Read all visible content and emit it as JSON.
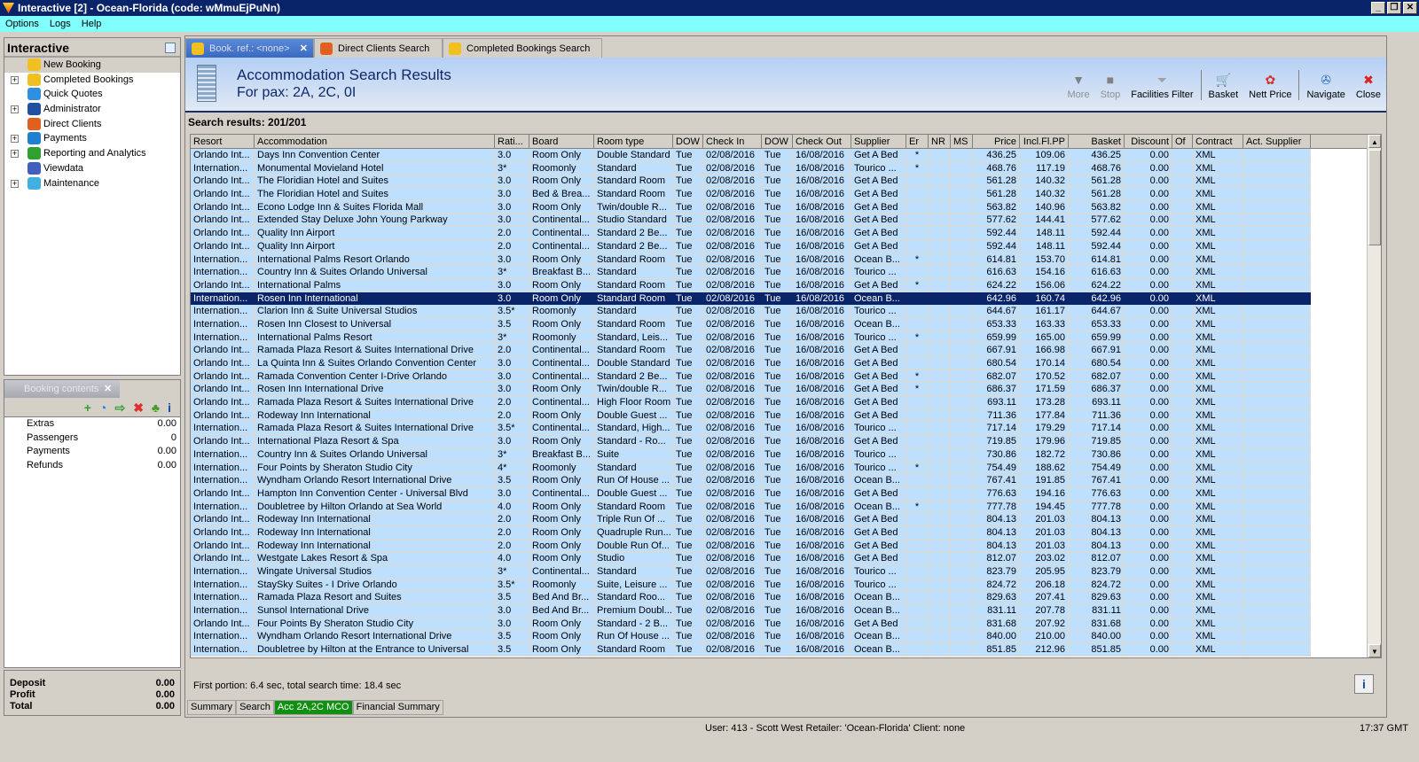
{
  "window": {
    "title": "Interactive [2] - Ocean-Florida (code: wMmuEjPuNn)",
    "buttons": [
      "_",
      "❐",
      "✕"
    ]
  },
  "menu": [
    "Options",
    "Logs",
    "Help"
  ],
  "sidebar": {
    "title": "Interactive",
    "items": [
      {
        "label": "New Booking",
        "expand": false,
        "color": "#f0c020"
      },
      {
        "label": "Completed Bookings",
        "expand": true,
        "color": "#f0c020"
      },
      {
        "label": "Quick Quotes",
        "expand": false,
        "color": "#3090e0"
      },
      {
        "label": "Administrator",
        "expand": true,
        "color": "#2050a0"
      },
      {
        "label": "Direct Clients",
        "expand": false,
        "color": "#e06020"
      },
      {
        "label": "Payments",
        "expand": true,
        "color": "#2080d0"
      },
      {
        "label": "Reporting and Analytics",
        "expand": true,
        "color": "#30a030"
      },
      {
        "label": "Viewdata",
        "expand": false,
        "color": "#4060c0"
      },
      {
        "label": "Maintenance",
        "expand": true,
        "color": "#40b0e0"
      }
    ]
  },
  "booking_contents": {
    "tab_label": "Booking contents",
    "rows": [
      {
        "label": "Extras",
        "value": "0.00"
      },
      {
        "label": "Passengers",
        "value": "0"
      },
      {
        "label": "Payments",
        "value": "0.00"
      },
      {
        "label": "Refunds",
        "value": "0.00"
      }
    ],
    "tools": [
      "+",
      "◔",
      "⇨",
      "✖",
      "♣",
      "i"
    ]
  },
  "totals": [
    {
      "label": "Deposit",
      "value": "0.00"
    },
    {
      "label": "Profit",
      "value": "0.00"
    },
    {
      "label": "Total",
      "value": "0.00"
    }
  ],
  "tabs": [
    {
      "label": "Book. ref.: <none>",
      "active": true
    },
    {
      "label": "Direct Clients Search",
      "active": false
    },
    {
      "label": "Completed Bookings Search",
      "active": false
    }
  ],
  "header": {
    "title": "Accommodation Search Results",
    "subtitle": "For pax: 2A, 2C, 0I"
  },
  "toolbar": [
    {
      "label": "More",
      "glyph": "▼",
      "disabled": true
    },
    {
      "label": "Stop",
      "glyph": "■",
      "disabled": true
    },
    {
      "label": "Facilities Filter",
      "glyph": "⏷",
      "disabled": false,
      "sep_after": true
    },
    {
      "label": "Basket",
      "glyph": "🛒",
      "disabled": false
    },
    {
      "label": "Nett Price",
      "glyph": "✿",
      "disabled": false,
      "sep_after": true
    },
    {
      "label": "Navigate",
      "glyph": "✇",
      "disabled": false
    },
    {
      "label": "Close",
      "glyph": "✖",
      "disabled": false
    }
  ],
  "results_label": "Search results: 201/201",
  "columns": [
    "Resort",
    "Accommodation",
    "Rati...",
    "Board",
    "Room type",
    "DOW",
    "Check In",
    "DOW",
    "Check Out",
    "Supplier",
    "Er",
    "NR",
    "MS",
    "Price",
    "Incl.Fl.PP",
    "Basket",
    "Discount",
    "Of",
    "Contract",
    "Act. Supplier"
  ],
  "selected_row": 11,
  "rows": [
    [
      "Orlando Int...",
      "Days Inn Convention Center",
      "3.0",
      "Room Only",
      "Double Standard",
      "Tue",
      "02/08/2016",
      "Tue",
      "16/08/2016",
      "Get A Bed",
      "*",
      "",
      "",
      "436.25",
      "109.06",
      "436.25",
      "0.00",
      "",
      "XML",
      ""
    ],
    [
      "Internation...",
      "Monumental Movieland Hotel",
      "3*",
      "Roomonly",
      "Standard",
      "Tue",
      "02/08/2016",
      "Tue",
      "16/08/2016",
      "Tourico ...",
      "*",
      "",
      "",
      "468.76",
      "117.19",
      "468.76",
      "0.00",
      "",
      "XML",
      ""
    ],
    [
      "Orlando Int...",
      "The Floridian Hotel and Suites",
      "3.0",
      "Room Only",
      "Standard Room",
      "Tue",
      "02/08/2016",
      "Tue",
      "16/08/2016",
      "Get A Bed",
      "",
      "",
      "",
      "561.28",
      "140.32",
      "561.28",
      "0.00",
      "",
      "XML",
      ""
    ],
    [
      "Orlando Int...",
      "The Floridian Hotel and Suites",
      "3.0",
      "Bed & Brea...",
      "Standard Room",
      "Tue",
      "02/08/2016",
      "Tue",
      "16/08/2016",
      "Get A Bed",
      "",
      "",
      "",
      "561.28",
      "140.32",
      "561.28",
      "0.00",
      "",
      "XML",
      ""
    ],
    [
      "Orlando Int...",
      "Econo Lodge Inn & Suites Florida Mall",
      "3.0",
      "Room Only",
      "Twin/double R...",
      "Tue",
      "02/08/2016",
      "Tue",
      "16/08/2016",
      "Get A Bed",
      "",
      "",
      "",
      "563.82",
      "140.96",
      "563.82",
      "0.00",
      "",
      "XML",
      ""
    ],
    [
      "Orlando Int...",
      "Extended Stay Deluxe John Young Parkway",
      "3.0",
      "Continental...",
      "Studio Standard",
      "Tue",
      "02/08/2016",
      "Tue",
      "16/08/2016",
      "Get A Bed",
      "",
      "",
      "",
      "577.62",
      "144.41",
      "577.62",
      "0.00",
      "",
      "XML",
      ""
    ],
    [
      "Orlando Int...",
      "Quality Inn Airport",
      "2.0",
      "Continental...",
      "Standard 2 Be...",
      "Tue",
      "02/08/2016",
      "Tue",
      "16/08/2016",
      "Get A Bed",
      "",
      "",
      "",
      "592.44",
      "148.11",
      "592.44",
      "0.00",
      "",
      "XML",
      ""
    ],
    [
      "Orlando Int...",
      "Quality Inn Airport",
      "2.0",
      "Continental...",
      "Standard 2 Be...",
      "Tue",
      "02/08/2016",
      "Tue",
      "16/08/2016",
      "Get A Bed",
      "",
      "",
      "",
      "592.44",
      "148.11",
      "592.44",
      "0.00",
      "",
      "XML",
      ""
    ],
    [
      "Internation...",
      "International Palms Resort Orlando",
      "3.0",
      "Room Only",
      "Standard Room",
      "Tue",
      "02/08/2016",
      "Tue",
      "16/08/2016",
      "Ocean B...",
      "*",
      "",
      "",
      "614.81",
      "153.70",
      "614.81",
      "0.00",
      "",
      "XML",
      ""
    ],
    [
      "Internation...",
      "Country Inn & Suites Orlando Universal",
      "3*",
      "Breakfast B...",
      "Standard",
      "Tue",
      "02/08/2016",
      "Tue",
      "16/08/2016",
      "Tourico ...",
      "",
      "",
      "",
      "616.63",
      "154.16",
      "616.63",
      "0.00",
      "",
      "XML",
      ""
    ],
    [
      "Orlando Int...",
      "International Palms",
      "3.0",
      "Room Only",
      "Standard Room",
      "Tue",
      "02/08/2016",
      "Tue",
      "16/08/2016",
      "Get A Bed",
      "*",
      "",
      "",
      "624.22",
      "156.06",
      "624.22",
      "0.00",
      "",
      "XML",
      ""
    ],
    [
      "Internation...",
      "Rosen Inn International",
      "3.0",
      "Room Only",
      "Standard Room",
      "Tue",
      "02/08/2016",
      "Tue",
      "16/08/2016",
      "Ocean B...",
      "",
      "",
      "",
      "642.96",
      "160.74",
      "642.96",
      "0.00",
      "",
      "XML",
      ""
    ],
    [
      "Internation...",
      "Clarion Inn & Suite Universal Studios",
      "3.5*",
      "Roomonly",
      "Standard",
      "Tue",
      "02/08/2016",
      "Tue",
      "16/08/2016",
      "Tourico ...",
      "",
      "",
      "",
      "644.67",
      "161.17",
      "644.67",
      "0.00",
      "",
      "XML",
      ""
    ],
    [
      "Internation...",
      "Rosen Inn Closest to Universal",
      "3.5",
      "Room Only",
      "Standard Room",
      "Tue",
      "02/08/2016",
      "Tue",
      "16/08/2016",
      "Ocean B...",
      "",
      "",
      "",
      "653.33",
      "163.33",
      "653.33",
      "0.00",
      "",
      "XML",
      ""
    ],
    [
      "Internation...",
      "International Palms Resort",
      "3*",
      "Roomonly",
      "Standard, Leis...",
      "Tue",
      "02/08/2016",
      "Tue",
      "16/08/2016",
      "Tourico ...",
      "*",
      "",
      "",
      "659.99",
      "165.00",
      "659.99",
      "0.00",
      "",
      "XML",
      ""
    ],
    [
      "Orlando Int...",
      "Ramada Plaza Resort & Suites International Drive",
      "2.0",
      "Continental...",
      "Standard Room",
      "Tue",
      "02/08/2016",
      "Tue",
      "16/08/2016",
      "Get A Bed",
      "",
      "",
      "",
      "667.91",
      "166.98",
      "667.91",
      "0.00",
      "",
      "XML",
      ""
    ],
    [
      "Orlando Int...",
      "La Quinta Inn & Suites Orlando Convention Center",
      "3.0",
      "Continental...",
      "Double Standard",
      "Tue",
      "02/08/2016",
      "Tue",
      "16/08/2016",
      "Get A Bed",
      "",
      "",
      "",
      "680.54",
      "170.14",
      "680.54",
      "0.00",
      "",
      "XML",
      ""
    ],
    [
      "Orlando Int...",
      "Ramada Convention Center I-Drive Orlando",
      "3.0",
      "Continental...",
      "Standard 2 Be...",
      "Tue",
      "02/08/2016",
      "Tue",
      "16/08/2016",
      "Get A Bed",
      "*",
      "",
      "",
      "682.07",
      "170.52",
      "682.07",
      "0.00",
      "",
      "XML",
      ""
    ],
    [
      "Orlando Int...",
      "Rosen Inn International Drive",
      "3.0",
      "Room Only",
      "Twin/double R...",
      "Tue",
      "02/08/2016",
      "Tue",
      "16/08/2016",
      "Get A Bed",
      "*",
      "",
      "",
      "686.37",
      "171.59",
      "686.37",
      "0.00",
      "",
      "XML",
      ""
    ],
    [
      "Orlando Int...",
      "Ramada Plaza Resort & Suites International Drive",
      "2.0",
      "Continental...",
      "High Floor Room",
      "Tue",
      "02/08/2016",
      "Tue",
      "16/08/2016",
      "Get A Bed",
      "",
      "",
      "",
      "693.11",
      "173.28",
      "693.11",
      "0.00",
      "",
      "XML",
      ""
    ],
    [
      "Orlando Int...",
      "Rodeway Inn International",
      "2.0",
      "Room Only",
      "Double Guest ...",
      "Tue",
      "02/08/2016",
      "Tue",
      "16/08/2016",
      "Get A Bed",
      "",
      "",
      "",
      "711.36",
      "177.84",
      "711.36",
      "0.00",
      "",
      "XML",
      ""
    ],
    [
      "Internation...",
      "Ramada Plaza Resort & Suites International Drive",
      "3.5*",
      "Continental...",
      "Standard, High...",
      "Tue",
      "02/08/2016",
      "Tue",
      "16/08/2016",
      "Tourico ...",
      "",
      "",
      "",
      "717.14",
      "179.29",
      "717.14",
      "0.00",
      "",
      "XML",
      ""
    ],
    [
      "Orlando Int...",
      "International Plaza Resort & Spa",
      "3.0",
      "Room Only",
      "Standard - Ro...",
      "Tue",
      "02/08/2016",
      "Tue",
      "16/08/2016",
      "Get A Bed",
      "",
      "",
      "",
      "719.85",
      "179.96",
      "719.85",
      "0.00",
      "",
      "XML",
      ""
    ],
    [
      "Internation...",
      "Country Inn & Suites Orlando Universal",
      "3*",
      "Breakfast B...",
      "Suite",
      "Tue",
      "02/08/2016",
      "Tue",
      "16/08/2016",
      "Tourico ...",
      "",
      "",
      "",
      "730.86",
      "182.72",
      "730.86",
      "0.00",
      "",
      "XML",
      ""
    ],
    [
      "Internation...",
      "Four Points by Sheraton Studio City",
      "4*",
      "Roomonly",
      "Standard",
      "Tue",
      "02/08/2016",
      "Tue",
      "16/08/2016",
      "Tourico ...",
      "*",
      "",
      "",
      "754.49",
      "188.62",
      "754.49",
      "0.00",
      "",
      "XML",
      ""
    ],
    [
      "Internation...",
      "Wyndham Orlando Resort International Drive",
      "3.5",
      "Room Only",
      "Run Of House ...",
      "Tue",
      "02/08/2016",
      "Tue",
      "16/08/2016",
      "Ocean B...",
      "",
      "",
      "",
      "767.41",
      "191.85",
      "767.41",
      "0.00",
      "",
      "XML",
      ""
    ],
    [
      "Orlando Int...",
      "Hampton Inn Convention Center - Universal Blvd",
      "3.0",
      "Continental...",
      "Double Guest ...",
      "Tue",
      "02/08/2016",
      "Tue",
      "16/08/2016",
      "Get A Bed",
      "",
      "",
      "",
      "776.63",
      "194.16",
      "776.63",
      "0.00",
      "",
      "XML",
      ""
    ],
    [
      "Internation...",
      "Doubletree by Hilton Orlando at Sea World",
      "4.0",
      "Room Only",
      "Standard Room",
      "Tue",
      "02/08/2016",
      "Tue",
      "16/08/2016",
      "Ocean B...",
      "*",
      "",
      "",
      "777.78",
      "194.45",
      "777.78",
      "0.00",
      "",
      "XML",
      ""
    ],
    [
      "Orlando Int...",
      "Rodeway Inn International",
      "2.0",
      "Room Only",
      "Triple Run Of ...",
      "Tue",
      "02/08/2016",
      "Tue",
      "16/08/2016",
      "Get A Bed",
      "",
      "",
      "",
      "804.13",
      "201.03",
      "804.13",
      "0.00",
      "",
      "XML",
      ""
    ],
    [
      "Orlando Int...",
      "Rodeway Inn International",
      "2.0",
      "Room Only",
      "Quadruple Run...",
      "Tue",
      "02/08/2016",
      "Tue",
      "16/08/2016",
      "Get A Bed",
      "",
      "",
      "",
      "804.13",
      "201.03",
      "804.13",
      "0.00",
      "",
      "XML",
      ""
    ],
    [
      "Orlando Int...",
      "Rodeway Inn International",
      "2.0",
      "Room Only",
      "Double Run Of...",
      "Tue",
      "02/08/2016",
      "Tue",
      "16/08/2016",
      "Get A Bed",
      "",
      "",
      "",
      "804.13",
      "201.03",
      "804.13",
      "0.00",
      "",
      "XML",
      ""
    ],
    [
      "Orlando Int...",
      "Westgate Lakes Resort & Spa",
      "4.0",
      "Room Only",
      "Studio",
      "Tue",
      "02/08/2016",
      "Tue",
      "16/08/2016",
      "Get A Bed",
      "",
      "",
      "",
      "812.07",
      "203.02",
      "812.07",
      "0.00",
      "",
      "XML",
      ""
    ],
    [
      "Internation...",
      "Wingate Universal Studios",
      "3*",
      "Continental...",
      "Standard",
      "Tue",
      "02/08/2016",
      "Tue",
      "16/08/2016",
      "Tourico ...",
      "",
      "",
      "",
      "823.79",
      "205.95",
      "823.79",
      "0.00",
      "",
      "XML",
      ""
    ],
    [
      "Internation...",
      "StaySky Suites - I Drive Orlando",
      "3.5*",
      "Roomonly",
      "Suite, Leisure ...",
      "Tue",
      "02/08/2016",
      "Tue",
      "16/08/2016",
      "Tourico ...",
      "",
      "",
      "",
      "824.72",
      "206.18",
      "824.72",
      "0.00",
      "",
      "XML",
      ""
    ],
    [
      "Internation...",
      "Ramada Plaza Resort and Suites",
      "3.5",
      "Bed And Br...",
      "Standard Roo...",
      "Tue",
      "02/08/2016",
      "Tue",
      "16/08/2016",
      "Ocean B...",
      "",
      "",
      "",
      "829.63",
      "207.41",
      "829.63",
      "0.00",
      "",
      "XML",
      ""
    ],
    [
      "Internation...",
      "Sunsol International Drive",
      "3.0",
      "Bed And Br...",
      "Premium Doubl...",
      "Tue",
      "02/08/2016",
      "Tue",
      "16/08/2016",
      "Ocean B...",
      "",
      "",
      "",
      "831.11",
      "207.78",
      "831.11",
      "0.00",
      "",
      "XML",
      ""
    ],
    [
      "Orlando Int...",
      "Four Points By Sheraton Studio City",
      "3.0",
      "Room Only",
      "Standard - 2 B...",
      "Tue",
      "02/08/2016",
      "Tue",
      "16/08/2016",
      "Get A Bed",
      "",
      "",
      "",
      "831.68",
      "207.92",
      "831.68",
      "0.00",
      "",
      "XML",
      ""
    ],
    [
      "Internation...",
      "Wyndham Orlando Resort International Drive",
      "3.5",
      "Room Only",
      "Run Of House ...",
      "Tue",
      "02/08/2016",
      "Tue",
      "16/08/2016",
      "Ocean B...",
      "",
      "",
      "",
      "840.00",
      "210.00",
      "840.00",
      "0.00",
      "",
      "XML",
      ""
    ],
    [
      "Internation...",
      "Doubletree by Hilton at the Entrance to Universal",
      "3.5",
      "Room Only",
      "Standard Room",
      "Tue",
      "02/08/2016",
      "Tue",
      "16/08/2016",
      "Ocean B...",
      "",
      "",
      "",
      "851.85",
      "212.96",
      "851.85",
      "0.00",
      "",
      "XML",
      ""
    ]
  ],
  "search_time": "First portion: 6.4 sec, total search time: 18.4 sec",
  "info_button": "i",
  "bottom_tabs": [
    {
      "label": "Summary",
      "active": false
    },
    {
      "label": "Search",
      "active": false
    },
    {
      "label": "Acc 2A,2C MCO",
      "active": true
    },
    {
      "label": "Financial Summary",
      "active": false
    }
  ],
  "status": {
    "user": "User: 413 - Scott West    Retailer: 'Ocean-Florida'    Client: none",
    "clock": "17:37 GMT"
  }
}
